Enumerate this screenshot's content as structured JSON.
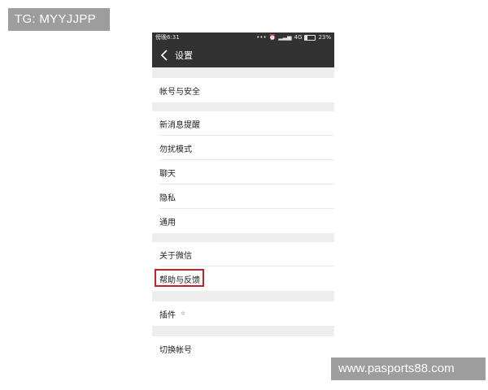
{
  "overlay": {
    "top_badge": "TG: MYYJJPP",
    "bottom_badge": "www.pasports88.com"
  },
  "statusbar": {
    "time": "傍晚6:31",
    "network": "4G",
    "battery_percent": "23%",
    "battery_level": 0.23
  },
  "navbar": {
    "title": "设置"
  },
  "sections": [
    {
      "items": [
        "帐号与安全"
      ]
    },
    {
      "items": [
        "新消息提醒",
        "勿扰模式",
        "聊天",
        "隐私",
        "通用"
      ]
    },
    {
      "items": [
        "关于微信",
        "帮助与反馈"
      ]
    },
    {
      "items": [
        "插件"
      ]
    },
    {
      "items": [
        "切换帐号"
      ]
    }
  ],
  "highlighted_item": "帮助与反馈",
  "colors": {
    "bar": "#323232",
    "separator": "#eeeeee",
    "highlight": "#c8202a"
  },
  "icons": {
    "back": "chevron-left-icon",
    "plugin": "badge-icon",
    "alarm": "alarm-icon",
    "signal": "signal-icon"
  }
}
